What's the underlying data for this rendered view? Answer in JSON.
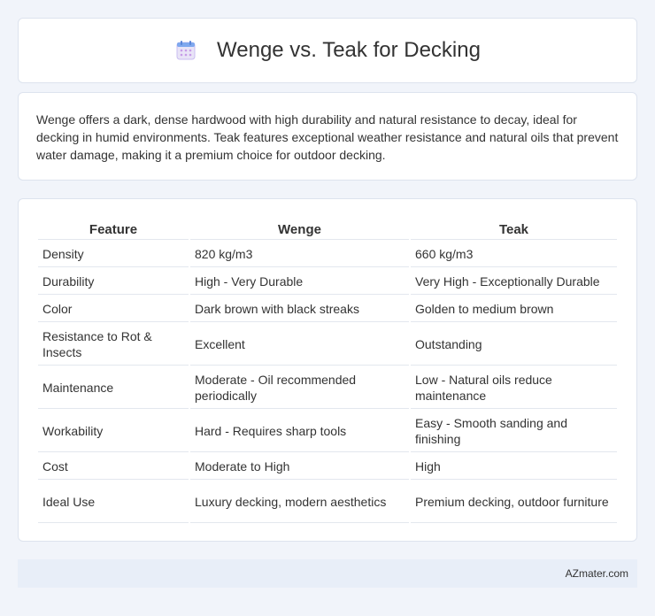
{
  "header": {
    "title": "Wenge vs. Teak for Decking",
    "icon": "calendar-icon"
  },
  "intro": {
    "text": "Wenge offers a dark, dense hardwood with high durability and natural resistance to decay, ideal for decking in humid environments. Teak features exceptional weather resistance and natural oils that prevent water damage, making it a premium choice for outdoor decking."
  },
  "table": {
    "headers": [
      "Feature",
      "Wenge",
      "Teak"
    ],
    "rows": [
      [
        "Density",
        "820 kg/m3",
        "660 kg/m3"
      ],
      [
        "Durability",
        "High - Very Durable",
        "Very High - Exceptionally Durable"
      ],
      [
        "Color",
        "Dark brown with black streaks",
        "Golden to medium brown"
      ],
      [
        "Resistance to Rot & Insects",
        "Excellent",
        "Outstanding"
      ],
      [
        "Maintenance",
        "Moderate - Oil recommended periodically",
        "Low - Natural oils reduce maintenance"
      ],
      [
        "Workability",
        "Hard - Requires sharp tools",
        "Easy - Smooth sanding and finishing"
      ],
      [
        "Cost",
        "Moderate to High",
        "High"
      ],
      [
        "Ideal Use",
        "Luxury decking, modern aesthetics",
        "Premium decking, outdoor furniture"
      ]
    ]
  },
  "footer": {
    "text": "AZmater.com"
  }
}
